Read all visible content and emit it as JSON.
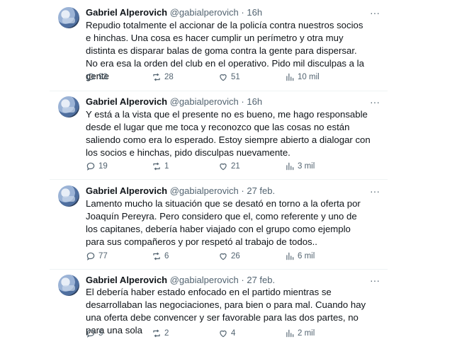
{
  "tweets": [
    {
      "name": "Gabriel Alperovich",
      "handle": "@gabialperovich",
      "time": "16h",
      "text": "Repudio totalmente el accionar de la policía contra nuestros socios e hinchas. Una cosa es hacer cumplir un perímetro y otra muy distinta es disparar balas de goma contra la gente para dispersar. No era esa la orden del club en el operativo. Pido mil disculpas a la gente",
      "replies": "93",
      "retweets": "28",
      "likes": "51",
      "views": "10 mil"
    },
    {
      "name": "Gabriel Alperovich",
      "handle": "@gabialperovich",
      "time": "16h",
      "text": "Y está a la vista que el presente no es bueno, me hago responsable desde el lugar que me toca y reconozco que las cosas no están saliendo como era lo esperado. Estoy siempre abierto a dialogar con los socios e hinchas, pido disculpas nuevamente.",
      "replies": "19",
      "retweets": "1",
      "likes": "21",
      "views": "3 mil"
    },
    {
      "name": "Gabriel Alperovich",
      "handle": "@gabialperovich",
      "time": "27 feb.",
      "text": "Lamento mucho la situación que se desató en torno a la oferta por Joaquín Pereyra. Pero considero que el, como referente y uno de los capitanes, debería haber viajado con el grupo como ejemplo para sus compañeros y por respetó al trabajo de todos..",
      "replies": "77",
      "retweets": "6",
      "likes": "26",
      "views": "6 mil"
    },
    {
      "name": "Gabriel Alperovich",
      "handle": "@gabialperovich",
      "time": "27 feb.",
      "text": "El debería haber estado enfocado en el partido mientras se desarrollaban las negociaciones, para bien o para mal. Cuando hay una oferta debe convencer y ser favorable para las dos partes, no para una sola",
      "replies": "5",
      "retweets": "2",
      "likes": "4",
      "views": "2 mil"
    }
  ],
  "separator": "·",
  "more_glyph": "···"
}
